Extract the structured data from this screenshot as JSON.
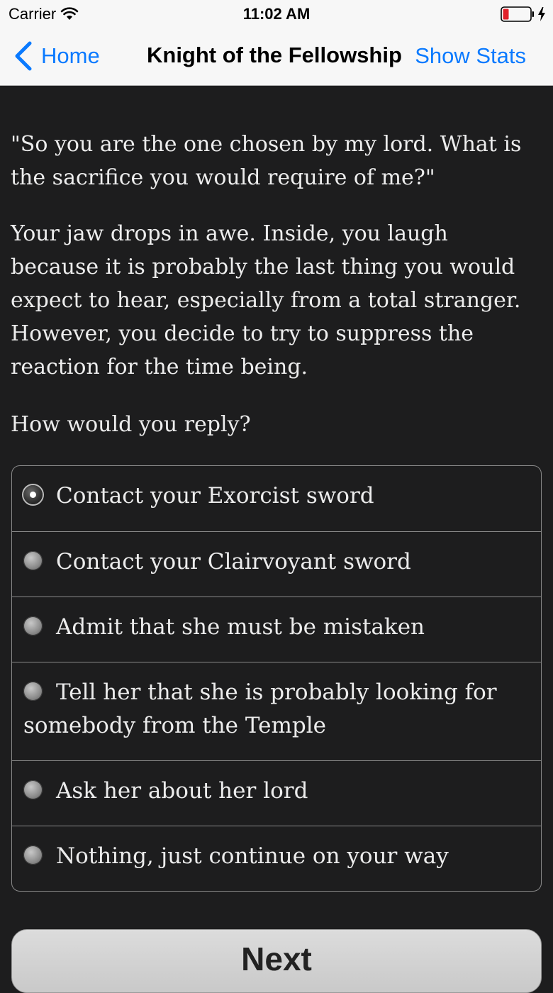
{
  "status_bar": {
    "carrier": "Carrier",
    "time": "11:02 AM",
    "battery_color": "#e0202a"
  },
  "nav": {
    "back_label": "Home",
    "title": "Knight of the Fellowship",
    "right_button": "Show Stats",
    "tint_color": "#0a7aff"
  },
  "story": {
    "paragraphs": [
      "\"So you are the one chosen by my lord. What is the sacrifice you would require of me?\"",
      "Your jaw drops in awe. Inside, you laugh because it is probably the last thing you would expect to hear, especially from a total stranger. However, you decide to try to suppress the reaction for the time being."
    ],
    "prompt": "How would you reply?"
  },
  "choices": [
    {
      "label": "Contact your Exorcist sword",
      "selected": true
    },
    {
      "label": "Contact your Clairvoyant sword",
      "selected": false
    },
    {
      "label": "Admit that she must be mistaken",
      "selected": false
    },
    {
      "label": "Tell her that she is probably looking for somebody from the Temple",
      "selected": false
    },
    {
      "label": "Ask her about her lord",
      "selected": false
    },
    {
      "label": "Nothing, just continue on your way",
      "selected": false
    }
  ],
  "next_button": "Next"
}
